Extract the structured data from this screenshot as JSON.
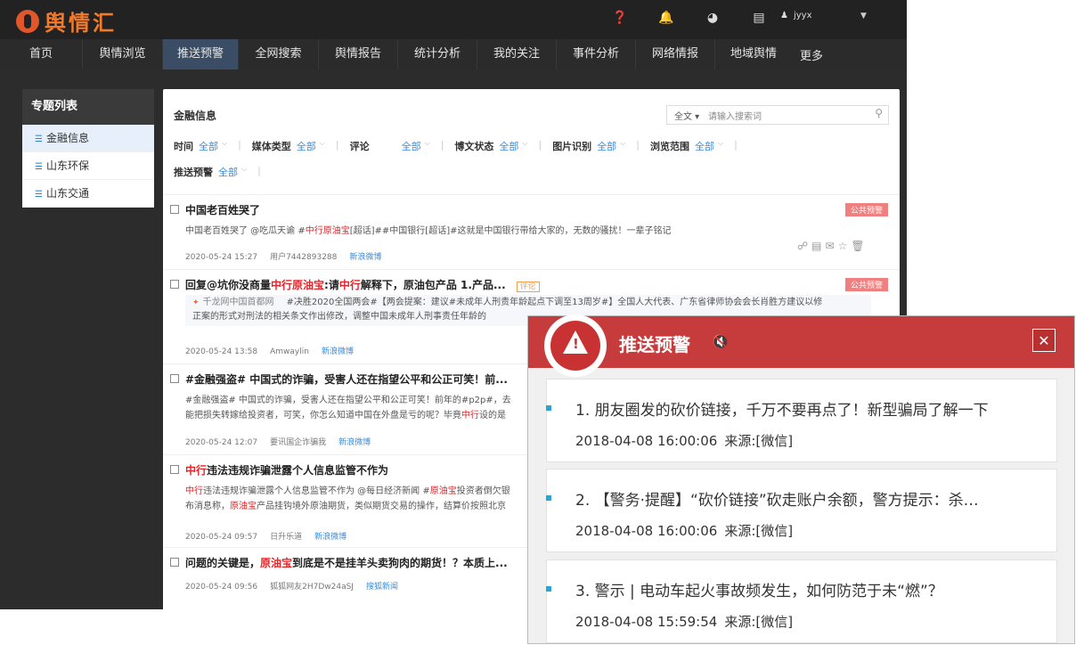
{
  "app": {
    "logo_text": "舆情汇",
    "user": "jyyx"
  },
  "nav": [
    "首页",
    "舆情浏览",
    "推送预警",
    "全网搜索",
    "舆情报告",
    "统计分析",
    "我的关注",
    "事件分析",
    "网络情报",
    "地域舆情",
    "更多"
  ],
  "sidebar": {
    "title": "专题列表",
    "items": [
      "金融信息",
      "山东环保",
      "山东交通"
    ]
  },
  "panel": {
    "title": "金融信息",
    "search": {
      "scope": "全文",
      "placeholder": "请输入搜索词"
    },
    "filters": {
      "time_label": "时间",
      "time_value": "全部",
      "media_label": "媒体类型",
      "media_value": "全部",
      "comment_label": "评论",
      "comment_value": "全部",
      "status_label": "博文状态",
      "status_value": "全部",
      "image_label": "图片识别",
      "image_value": "全部",
      "range_label": "浏览范围",
      "range_value": "全部",
      "push_label": "推送预警",
      "push_value": "全部"
    }
  },
  "items": [
    {
      "title": "中国老百姓哭了",
      "tag": "公共预警",
      "body_a": "中国老百姓哭了 @吃瓜天谕 #",
      "body_hl": "中行原油宝",
      "body_b": "[超话]##中国银行[超话]#这就是中国银行带给大家的，无数的骚扰！一辈子铭记",
      "time": "2020-05-24 15:27",
      "user": "用户7442893288",
      "source": "新浪微博"
    },
    {
      "title_a": "回复@坑你没商量",
      "title_hl1": "中行原油宝",
      "title_b": ":请",
      "title_hl2": "中行",
      "title_c": "解释下，原油包产品 1.产品...",
      "comment_tag": "评论",
      "tag": "公共预警",
      "quote_src": "千龙网中国首都网",
      "quote_line1": "#决胜2020全国两会#【两会提案：建议#未成年人刑责年龄起点下调至13周岁#】全国人大代表、广东省律师协会会长肖胜方建议以修",
      "quote_line2": "正案的形式对刑法的相关条文作出修改，调整中国未成年人刑事责任年龄的",
      "time": "2020-05-24 13:58",
      "user": "Amwaylin",
      "source": "新浪微博"
    },
    {
      "title": "#金融强盗# 中国式的诈骗，受害人还在指望公平和公正可笑！前...",
      "body_line1": "#金融强盗# 中国式的诈骗，受害人还在指望公平和公正可笑！前年的#p2p#，去",
      "body_line2_a": "能把损失转嫁给投资者，可笑，你怎么知道中国在外盘是亏的呢？毕竟",
      "body_line2_hl": "中行",
      "body_line2_b": "设的是",
      "time": "2020-05-24 12:07",
      "user": "要讯国企诈骗我",
      "source": "新浪微博"
    },
    {
      "title_hl": "中行",
      "title_rest": "违法违规诈骗泄露个人信息监管不作为",
      "body_l1_hl": "中行",
      "body_l1_a": "违法违规诈骗泄露个人信息监管不作为 @每日经济新闻 #",
      "body_l1_hl2": "原油宝",
      "body_l1_b": "投资者倒欠银",
      "body_l2_a": "布消息称，",
      "body_l2_hl": "原油宝",
      "body_l2_b": "产品挂钩境外原油期货，类似期货交易的操作，结算价按照北京",
      "time": "2020-05-24 09:57",
      "user": "日升乐道",
      "source": "新浪微博"
    },
    {
      "title_a": "问题的关键是，",
      "title_hl": "原油宝",
      "title_b": "到底是不是挂羊头卖狗肉的期货！？本质上...",
      "time": "2020-05-24 09:56",
      "user": "狐狐网友2H7Dw24aSJ",
      "source": "搜狐新闻"
    }
  ],
  "popup": {
    "title": "推送预警",
    "alerts": [
      {
        "text": "1. 朋友圈发的砍价链接，千万不要再点了！新型骗局了解一下",
        "time": "2018-04-08 16:00:06",
        "source": "来源:[微信]"
      },
      {
        "text": "2. 【警务·提醒】“砍价链接”砍走账户余额，警方提示：杀…",
        "time": "2018-04-08 16:00:06",
        "source": "来源:[微信]"
      },
      {
        "text": "3. 警示 | 电动车起火事故频发生，如何防范于未“燃”？",
        "time": "2018-04-08 15:59:54",
        "source": "来源:[微信]"
      }
    ]
  },
  "colors": {
    "nav_active": "#3a4d64",
    "highlight": "#e0262a",
    "link": "#3b8bd9",
    "popup_header": "#c63c3c",
    "tag": "#f08080"
  }
}
